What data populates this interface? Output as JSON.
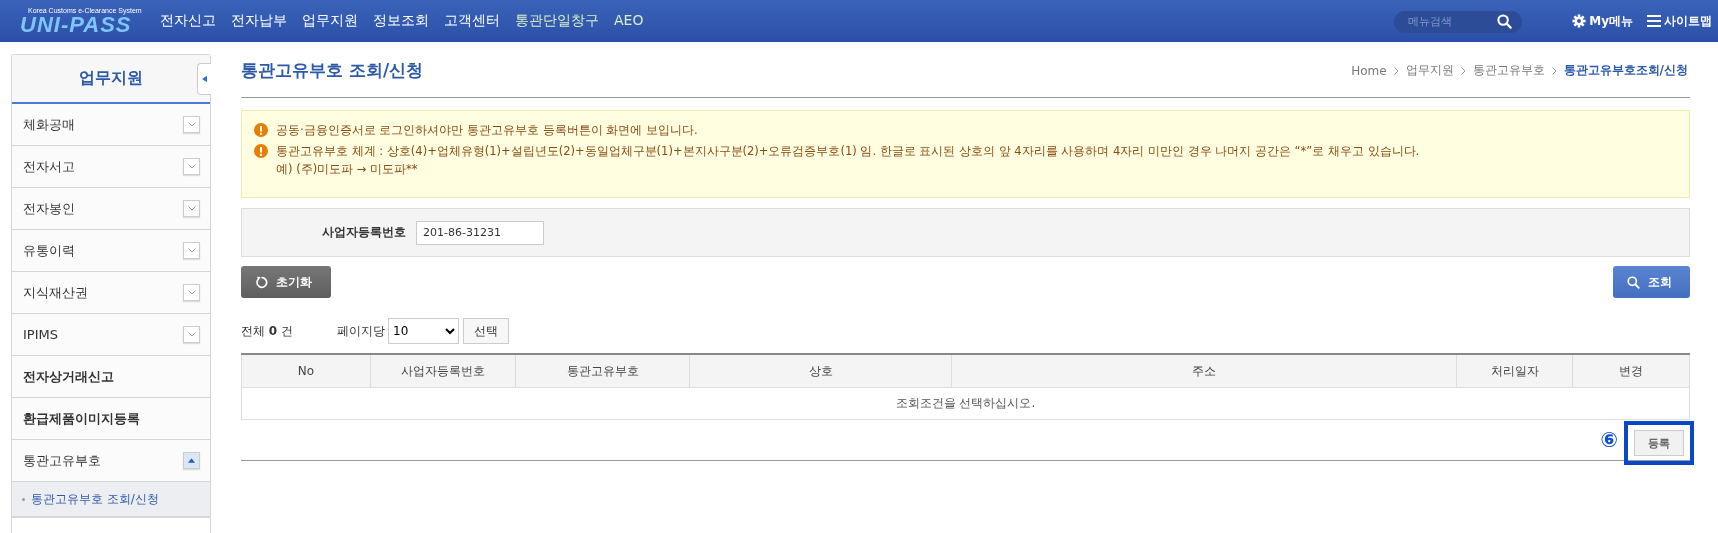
{
  "header": {
    "logo_caption": "Korea Customs e-Clearance System",
    "logo_text": "UNI-PASS",
    "nav": [
      {
        "label": "전자신고",
        "kind": "main"
      },
      {
        "label": "전자납부",
        "kind": "main"
      },
      {
        "label": "업무지원",
        "kind": "main"
      },
      {
        "label": "정보조회",
        "kind": "main"
      },
      {
        "label": "고객센터",
        "kind": "main"
      },
      {
        "label": "통관단일창구",
        "kind": "accent"
      },
      {
        "label": "AEO",
        "kind": "accent"
      }
    ],
    "search": {
      "placeholder": "메뉴검색"
    },
    "my_menu": "My메뉴",
    "sitemap": "사이트맵"
  },
  "sidebar": {
    "title": "업무지원",
    "items": [
      {
        "label": "체화공매",
        "kind": "group",
        "expanded": false
      },
      {
        "label": "전자서고",
        "kind": "group",
        "expanded": false
      },
      {
        "label": "전자봉인",
        "kind": "group",
        "expanded": false
      },
      {
        "label": "유통이력",
        "kind": "group",
        "expanded": false
      },
      {
        "label": "지식재산권",
        "kind": "group",
        "expanded": false
      },
      {
        "label": "IPIMS",
        "kind": "group",
        "expanded": false
      },
      {
        "label": "전자상거래신고",
        "kind": "link"
      },
      {
        "label": "환급제품이미지등록",
        "kind": "link"
      },
      {
        "label": "통관고유부호",
        "kind": "group",
        "expanded": true,
        "children": [
          {
            "label": "통관고유부호 조회/신청",
            "selected": true
          }
        ]
      }
    ]
  },
  "page": {
    "title": "통관고유부호 조회/신청",
    "breadcrumb": [
      "Home",
      "업무지원",
      "통관고유부호",
      "통관고유부호조회/신청"
    ],
    "notices": [
      {
        "lines": [
          "공동·금융인증서로 로그인하셔야만 통관고유부호 등록버튼이 화면에 보입니다."
        ]
      },
      {
        "lines": [
          "통관고유부호 체계 : 상호(4)+업체유형(1)+설립년도(2)+동일업체구분(1)+본지사구분(2)+오류검증부호(1) 임. 한글로 표시된 상호의 앞 4자리를 사용하며 4자리 미만인 경우 나머지 공간은 “*”로 채우고 있습니다.",
          "예) (주)미도파 → 미도파**"
        ]
      }
    ],
    "search_form": {
      "label": "사업자등록번호",
      "value": "201-86-31231"
    },
    "reset_button": "초기화",
    "search_button": "조회",
    "total": {
      "prefix": "전체",
      "count": "0",
      "suffix": "건"
    },
    "page_size": {
      "label": "페이지당",
      "value": "10",
      "button": "선택"
    },
    "table": {
      "columns": [
        "No",
        "사업자등록번호",
        "통관고유부호",
        "상호",
        "주소",
        "처리일자",
        "변경"
      ],
      "empty_message": "조회조건을 선택하십시오."
    },
    "register_button": "등록",
    "annotation": {
      "label": "⑥"
    }
  }
}
